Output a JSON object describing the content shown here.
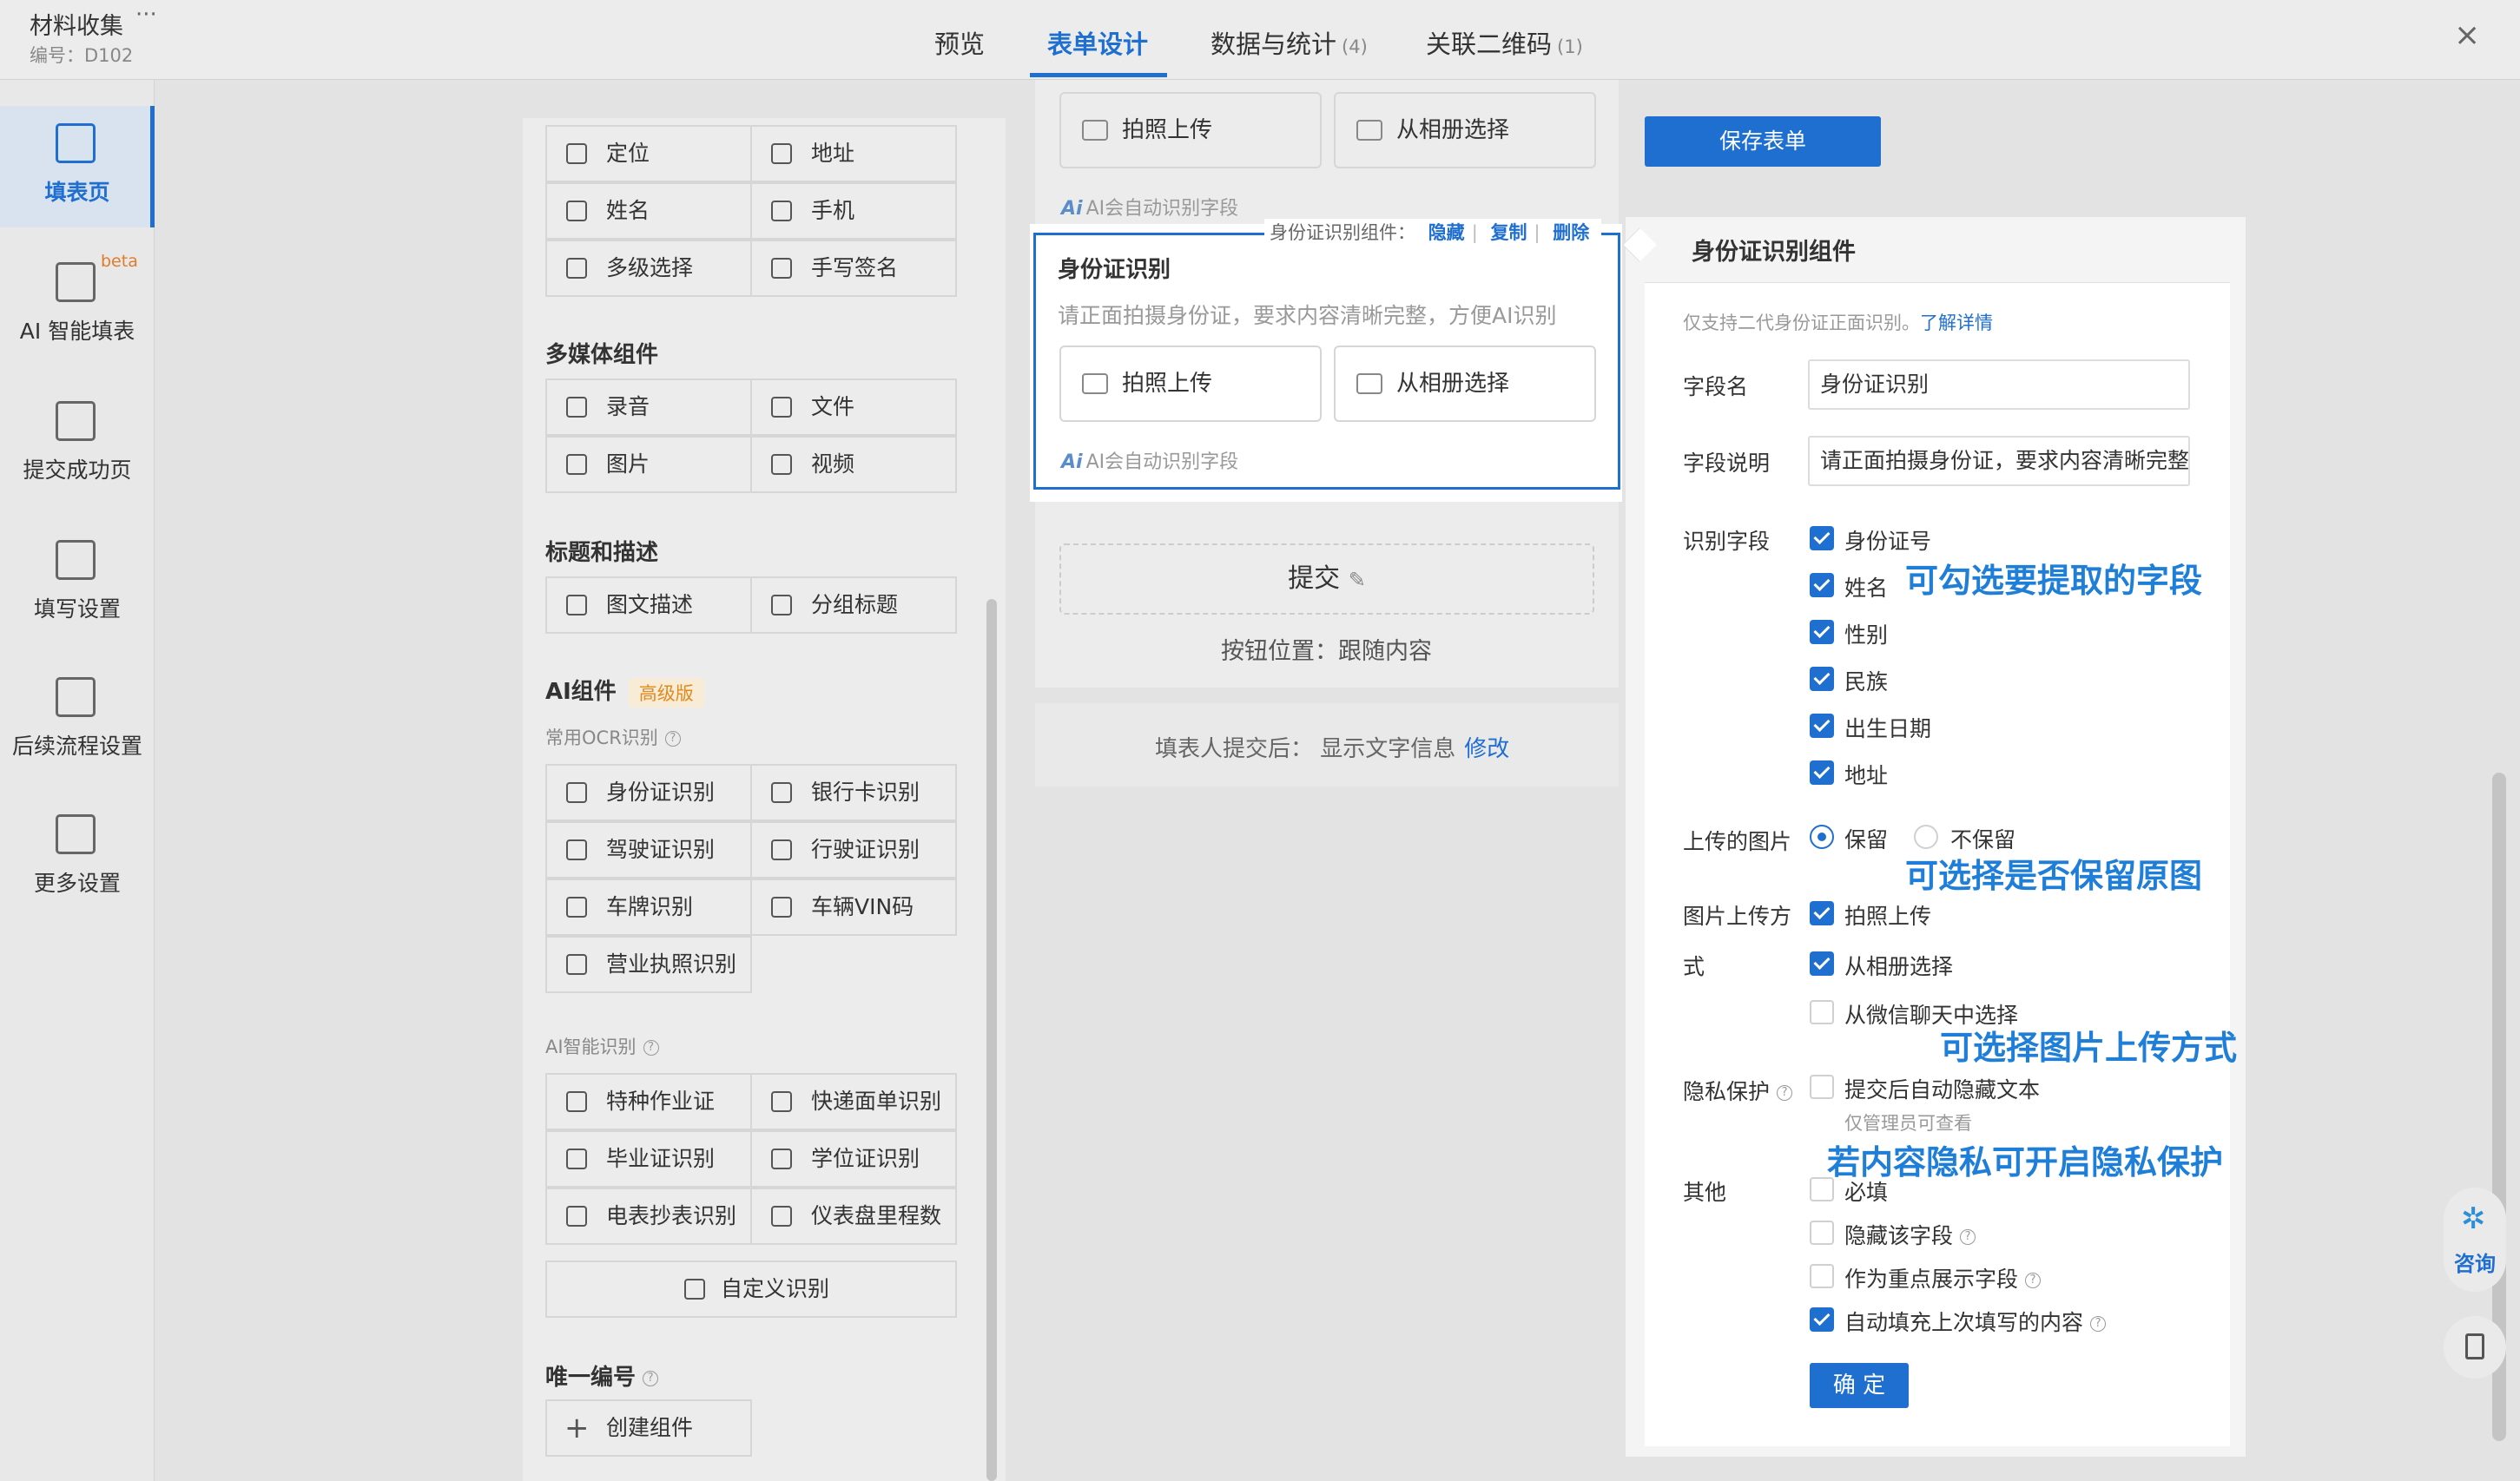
{
  "app": {
    "title": "材料收集",
    "more": "···",
    "code": "编号：D102",
    "close": "×"
  },
  "tabs": [
    {
      "label": "预览",
      "count": ""
    },
    {
      "label": "表单设计",
      "count": ""
    },
    {
      "label": "数据与统计",
      "count": "(4)"
    },
    {
      "label": "关联二维码",
      "count": "(1)"
    }
  ],
  "leftnav": [
    {
      "label": "填表页",
      "icon": "form-page-icon"
    },
    {
      "label": "AI 智能填表",
      "icon": "ai-fill-icon",
      "badge": "beta"
    },
    {
      "label": "提交成功页",
      "icon": "success-page-icon"
    },
    {
      "label": "填写设置",
      "icon": "edit-settings-icon"
    },
    {
      "label": "后续流程设置",
      "icon": "flow-settings-icon"
    },
    {
      "label": "更多设置",
      "icon": "more-settings-icon"
    }
  ],
  "components": {
    "basic": [
      "定位",
      "地址",
      "姓名",
      "手机",
      "多级选择",
      "手写签名"
    ],
    "media_title": "多媒体组件",
    "media": [
      "录音",
      "文件",
      "图片",
      "视频"
    ],
    "heading_title": "标题和描述",
    "heading": [
      "图文描述",
      "分组标题"
    ],
    "ai_title": "AI组件",
    "ai_badge": "高级版",
    "ocr_title": "常用OCR识别",
    "ocr": [
      "身份证识别",
      "银行卡识别",
      "驾驶证识别",
      "行驶证识别",
      "车牌识别",
      "车辆VIN码",
      "营业执照识别"
    ],
    "smart_title": "AI智能识别",
    "smart": [
      "特种作业证",
      "快递面单识别",
      "毕业证识别",
      "学位证识别",
      "电表抄表识别",
      "仪表盘里程数"
    ],
    "custom": "自定义识别",
    "unique_title": "唯一编号",
    "create": "创建组件"
  },
  "canvas": {
    "photo_upload": "拍照上传",
    "album_select": "从相册选择",
    "ai_hint": "AI会自动识别字段",
    "toolbar_label": "身份证识别组件：",
    "toolbar_hide": "隐藏",
    "toolbar_copy": "复制",
    "toolbar_delete": "删除",
    "id_title": "身份证识别",
    "id_desc": "请正面拍摄身份证，要求内容清晰完整，方便AI识别",
    "submit": "提交",
    "button_position": "按钮位置：跟随内容",
    "after_submit": "填表人提交后：  显示文字信息",
    "after_submit_link": "修改"
  },
  "save_button": "保存表单",
  "props": {
    "title": "身份证识别组件",
    "note": "仅支持二代身份证正面识别。",
    "note_link": "了解详情",
    "field_name_label": "字段名",
    "field_name_value": "身份证识别",
    "field_desc_label": "字段说明",
    "field_desc_value": "请正面拍摄身份证，要求内容清晰完整",
    "recognize_label": "识别字段",
    "recognize_fields": [
      {
        "label": "身份证号",
        "checked": true
      },
      {
        "label": "姓名",
        "checked": true
      },
      {
        "label": "性别",
        "checked": true
      },
      {
        "label": "民族",
        "checked": true
      },
      {
        "label": "出生日期",
        "checked": true
      },
      {
        "label": "地址",
        "checked": true
      }
    ],
    "uploaded_label": "上传的图片",
    "keep": "保留",
    "not_keep": "不保留",
    "upload_method_label_1": "图片上传方",
    "upload_method_label_2": "式",
    "upload_methods": [
      {
        "label": "拍照上传",
        "checked": true
      },
      {
        "label": "从相册选择",
        "checked": true
      },
      {
        "label": "从微信聊天中选择",
        "checked": false
      }
    ],
    "privacy_label": "隐私保护",
    "privacy_option": "提交后自动隐藏文本",
    "privacy_hint": "仅管理员可查看",
    "other_label": "其他",
    "other_options": [
      {
        "label": "必填",
        "checked": false
      },
      {
        "label": "隐藏该字段",
        "checked": false
      },
      {
        "label": "作为重点展示字段",
        "checked": false
      },
      {
        "label": "自动填充上次填写的内容",
        "checked": true
      }
    ],
    "ok": "确 定"
  },
  "annotations": [
    "可勾选要提取的字段",
    "可选择是否保留原图",
    "可选择图片上传方式",
    "若内容隐私可开启隐私保护"
  ],
  "consult": "咨询",
  "colors": {
    "accent": "#1f6fd0",
    "annotation": "#1f7fd8",
    "badge": "#e08a1e"
  }
}
